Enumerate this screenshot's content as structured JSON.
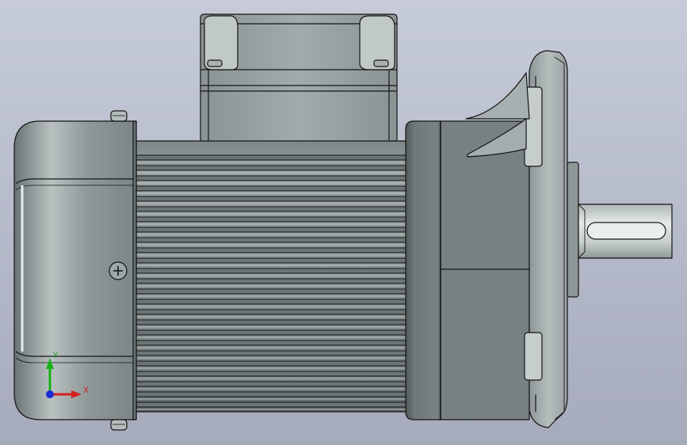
{
  "viewport": {
    "background_top": "#c3c8d6",
    "background_bottom": "#a8adbd",
    "model_body_color": "#8b9494",
    "model_dark_color": "#5f6868",
    "model_light_color": "#c4cbcb",
    "edge_color": "#1a1a1a"
  },
  "triad": {
    "x_label": "X",
    "y_label": "Y",
    "x_color": "#d62020",
    "y_color": "#18b018",
    "z_color": "#1a2ad8"
  },
  "model_parts": [
    {
      "name": "terminal-box",
      "icon": "box-icon"
    },
    {
      "name": "fan-cover",
      "icon": "cylinder-icon"
    },
    {
      "name": "cooling-fins",
      "icon": "fins-icon"
    },
    {
      "name": "gear-housing",
      "icon": "cylinder-icon"
    },
    {
      "name": "mounting-flange",
      "icon": "flange-icon"
    },
    {
      "name": "output-shaft",
      "icon": "shaft-icon"
    },
    {
      "name": "cover-screw",
      "icon": "screw-icon"
    }
  ]
}
